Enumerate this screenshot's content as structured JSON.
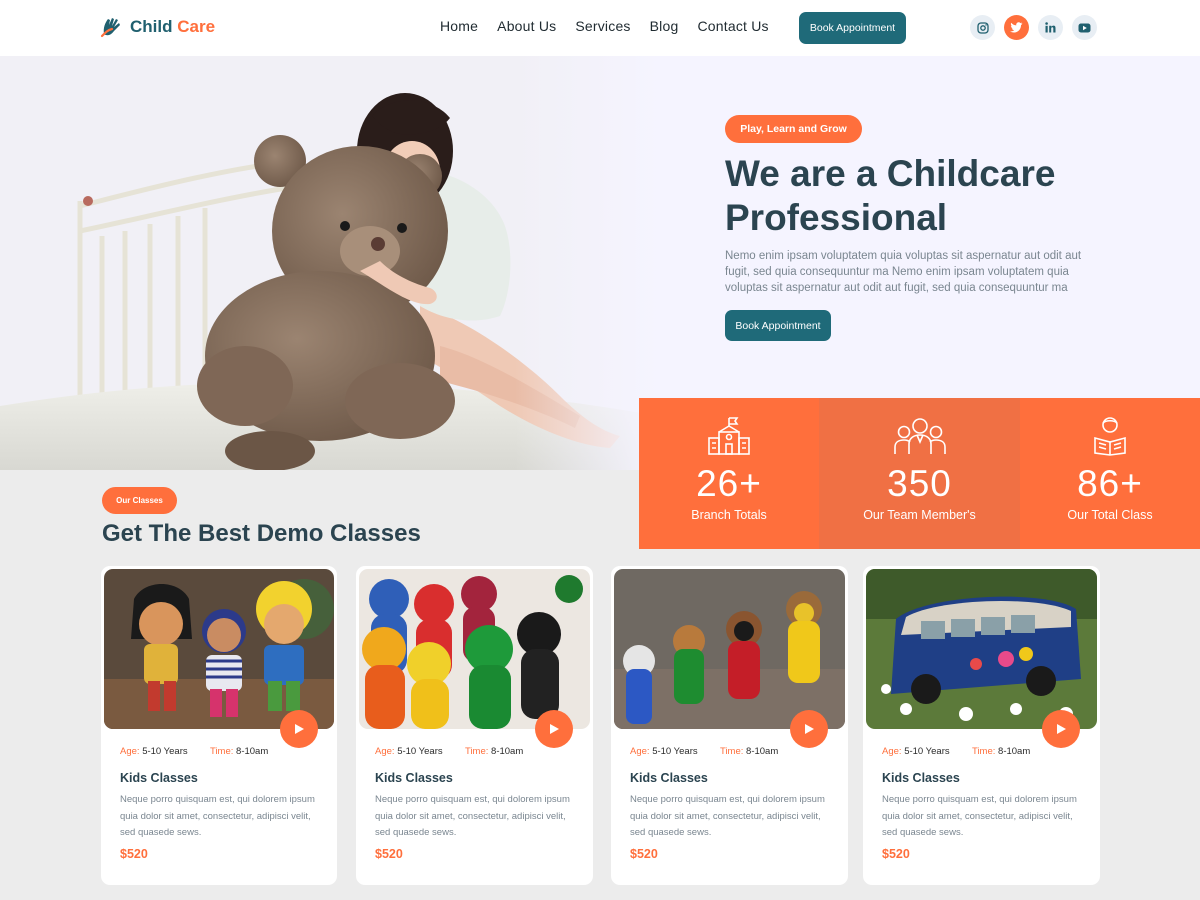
{
  "brand": {
    "name_part1": "Child",
    "name_part2": "Care"
  },
  "nav": [
    {
      "label": "Home"
    },
    {
      "label": "About Us"
    },
    {
      "label": "Services"
    },
    {
      "label": "Blog"
    },
    {
      "label": "Contact Us"
    }
  ],
  "header_button": "Book Appointment",
  "socials": [
    "instagram-icon",
    "twitter-icon",
    "linkedin-icon",
    "youtube-icon"
  ],
  "hero": {
    "tag": "Play, Learn and Grow",
    "title": "We are a Childcare Professional",
    "description": "Nemo enim ipsam voluptatem quia voluptas sit aspernatur aut odit aut fugit, sed quia consequuntur ma Nemo enim ipsam voluptatem quia voluptas sit aspernatur aut odit aut fugit, sed quia consequuntur ma",
    "button": "Book Appointment"
  },
  "stats": [
    {
      "value": "26+",
      "label": "Branch Totals",
      "icon": "school-building-icon"
    },
    {
      "value": "350",
      "label": "Our Team Member's",
      "icon": "team-members-icon"
    },
    {
      "value": "86+",
      "label": "Our Total Class",
      "icon": "student-reading-icon"
    }
  ],
  "classes_section": {
    "tag": "Our Classes",
    "title": "Get The Best Demo Classes"
  },
  "cards": [
    {
      "age_label": "Age:",
      "age": "5-10 Years",
      "time_label": "Time:",
      "time": "8-10am",
      "title": "Kids Classes",
      "desc": "Neque porro quisquam est, qui dolorem ipsum quia dolor sit amet, consectetur, adipisci velit, sed quasede sews.",
      "price": "$520",
      "image": "wooden-dolls-photo"
    },
    {
      "age_label": "Age:",
      "age": "5-10 Years",
      "time_label": "Time:",
      "time": "8-10am",
      "title": "Kids Classes",
      "desc": "Neque porro quisquam est, qui dolorem ipsum quia dolor sit amet, consectetur, adipisci velit, sed quasede sews.",
      "price": "$520",
      "image": "wooden-pegs-photo"
    },
    {
      "age_label": "Age:",
      "age": "5-10 Years",
      "time_label": "Time:",
      "time": "8-10am",
      "title": "Kids Classes",
      "desc": "Neque porro quisquam est, qui dolorem ipsum quia dolor sit amet, consectetur, adipisci velit, sed quasede sews.",
      "price": "$520",
      "image": "peg-puppets-photo"
    },
    {
      "age_label": "Age:",
      "age": "5-10 Years",
      "time_label": "Time:",
      "time": "8-10am",
      "title": "Kids Classes",
      "desc": "Neque porro quisquam est, qui dolorem ipsum quia dolor sit amet, consectetur, adipisci velit, sed quasede sews.",
      "price": "$520",
      "image": "toy-van-photo"
    }
  ],
  "colors": {
    "accent": "#ff6f3c",
    "primary": "#1f6a79",
    "heading": "#2b4450",
    "stat_mid": "#f07044"
  }
}
